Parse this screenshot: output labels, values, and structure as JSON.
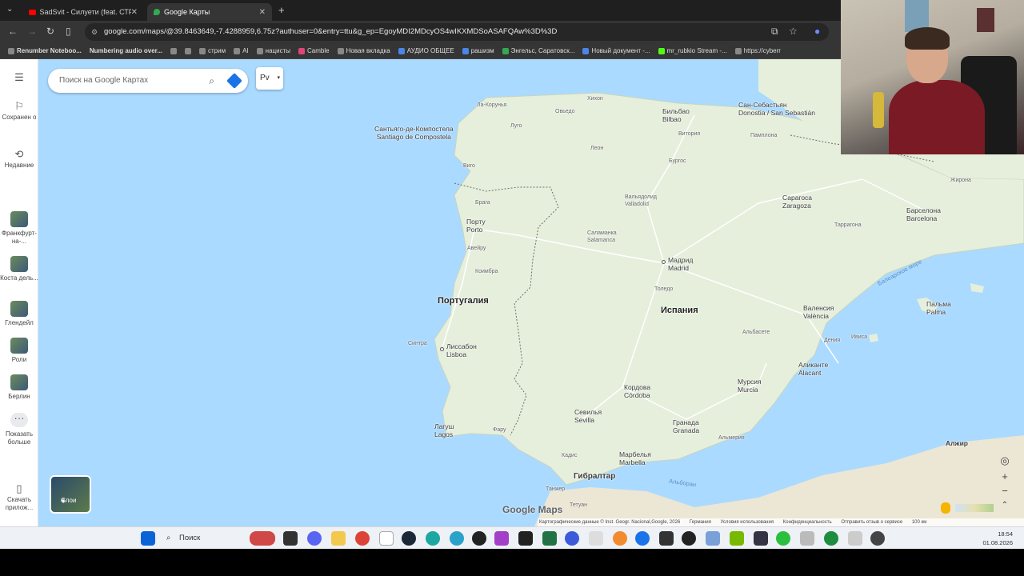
{
  "browser": {
    "tabs": [
      {
        "title": "SadSvit - Силуети (feat. СТРУКТ",
        "active": false
      },
      {
        "title": "Google Карты",
        "active": true
      }
    ],
    "url": "google.com/maps/@39.8463649,-7.4288959,6.75z?authuser=0&entry=ttu&g_ep=EgoyMDI2MDcyOS4wIKXMDSoASAFQAw%3D%3D",
    "bookmarks": [
      "Renumber Noteboo...",
      "Numbering audio over...",
      "стрим",
      "AI",
      "нацисты",
      "Camble",
      "Новая вкладка",
      "АУДИО ОБЩЕЕ",
      "рашизм",
      "Энгельс, Саратовск...",
      "Новый документ -...",
      "mr_rubkio Stream -...",
      "https://cyberr"
    ]
  },
  "sidebar": {
    "items": [
      {
        "label": "Сохранен о",
        "icon": "bookmark-icon"
      },
      {
        "label": "Недавние",
        "icon": "history-icon"
      },
      {
        "label": "Франкфурт-на-...",
        "icon": "thumb"
      },
      {
        "label": "Коста дель...",
        "icon": "thumb"
      },
      {
        "label": "Глендейл",
        "icon": "thumb"
      },
      {
        "label": "Роли",
        "icon": "thumb"
      },
      {
        "label": "Берлин",
        "icon": "thumb"
      },
      {
        "label": "Показать больше",
        "icon": "more-icon"
      },
      {
        "label": "Скачать прилож...",
        "icon": "phone-icon"
      }
    ]
  },
  "map": {
    "search_placeholder": "Поиск на Google Картах",
    "chip_label": "Рv",
    "countries": [
      "Португалия",
      "Испания"
    ],
    "cities": [
      {
        "ru": "Мадрид",
        "orig": "Madrid"
      },
      {
        "ru": "Барселона",
        "orig": "Barcelona"
      },
      {
        "ru": "Валенсия",
        "orig": "València"
      },
      {
        "ru": "Севилья",
        "orig": "Sevilla"
      },
      {
        "ru": "Лиссабон",
        "orig": "Lisboa"
      },
      {
        "ru": "Порту",
        "orig": "Porto"
      },
      {
        "ru": "Сарагоса",
        "orig": "Zaragoza"
      },
      {
        "ru": "Бильбао",
        "orig": "Bilbao"
      },
      {
        "ru": "Сан-Себастьян",
        "orig": "Donostia / San Sebastián"
      },
      {
        "ru": "Сантьяго-де-Компостела",
        "orig": "Santiago de Compostela"
      },
      {
        "ru": "Кордова",
        "orig": "Córdoba"
      },
      {
        "ru": "Гранада",
        "orig": "Granada"
      },
      {
        "ru": "Марбелья",
        "orig": "Marbella"
      },
      {
        "ru": "Мурсия",
        "orig": "Murcia"
      },
      {
        "ru": "Аликанте",
        "orig": "Alacant"
      },
      {
        "ru": "Пальма",
        "orig": "Palma"
      },
      {
        "ru": "Лагуш",
        "orig": "Lagos"
      },
      {
        "ru": "Вальядолид",
        "orig": "Valladolid"
      },
      {
        "ru": "Саламанка",
        "orig": "Salamanca"
      }
    ],
    "small_places": [
      "Ла-Корунья",
      "Хихон",
      "Овьедо",
      "Луго",
      "Леон",
      "Бургос",
      "Витория",
      "Памплона",
      "Виго",
      "Брага",
      "Авейру",
      "Коимбра",
      "Толедо",
      "Альбасете",
      "Синтра",
      "Кадис",
      "Фару",
      "Альмерия",
      "Таррагона",
      "Жирона",
      "Ивиса",
      "Дения",
      "Танжер",
      "Тетуан",
      "Алжир",
      "Гибралтар"
    ],
    "seas": [
      "Балеарское море",
      "Альборан"
    ],
    "logo": "Google Maps",
    "attribution": [
      "Картографические данные © Inst. Geogr. Nacional,Google, 2026",
      "Германия",
      "Условия использования",
      "Конфиденциальность",
      "Отправить отзыв о сервисе",
      "100 км"
    ],
    "layers_label": "Слои"
  },
  "taskbar": {
    "search_label": "Поиск",
    "time": "18:54",
    "date": "01.08.2026"
  },
  "colors": {
    "water": "#aadaff",
    "land": "#e8f0e0",
    "accent": "#1a73e8"
  }
}
